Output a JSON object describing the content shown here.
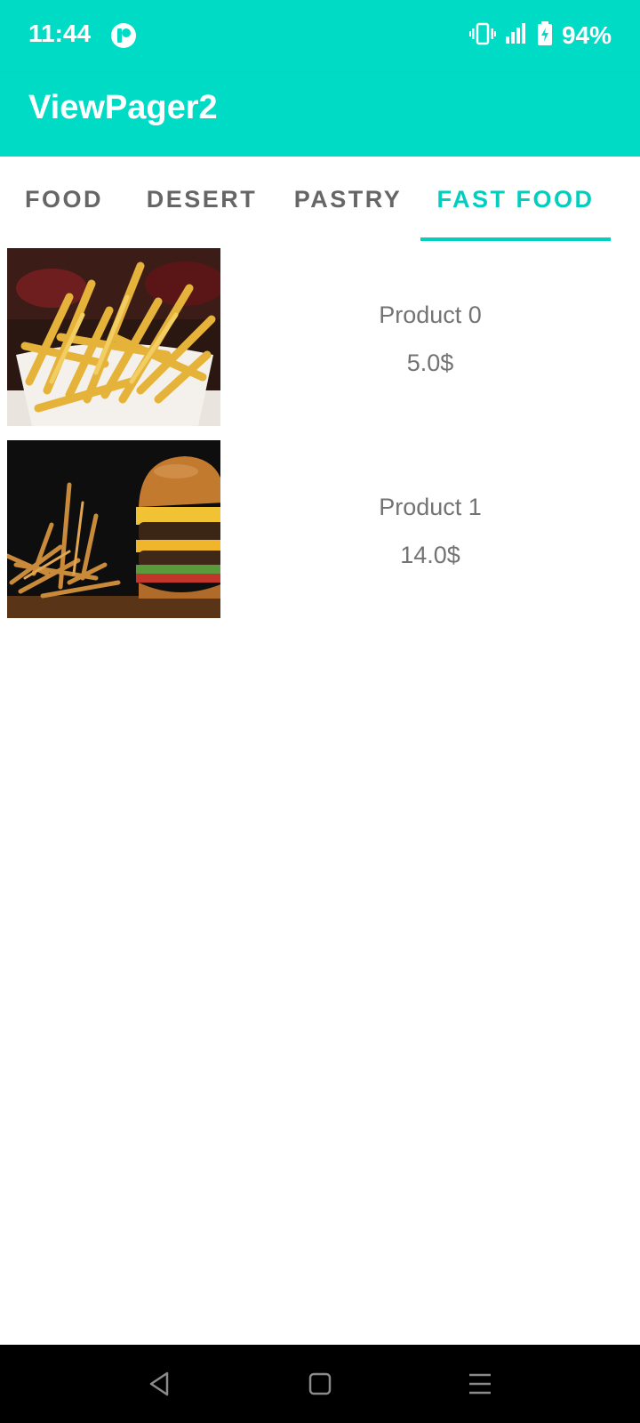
{
  "status_bar": {
    "time": "11:44",
    "battery": "94%",
    "icons": [
      "app-notification-icon",
      "vibrate-icon",
      "signal-icon",
      "battery-charging-icon"
    ]
  },
  "app_bar": {
    "title": "ViewPager2"
  },
  "tabs": [
    {
      "label": "FOOD",
      "active": false
    },
    {
      "label": "DESERT",
      "active": false
    },
    {
      "label": "PASTRY",
      "active": false
    },
    {
      "label": "FAST FOOD",
      "active": true
    }
  ],
  "products": [
    {
      "name": "Product 0",
      "price": "5.0$",
      "image": "french-fries-photo"
    },
    {
      "name": "Product 1",
      "price": "14.0$",
      "image": "burger-and-fries-photo"
    }
  ],
  "nav_bar": {
    "icons": [
      "back-icon",
      "home-icon",
      "recents-icon"
    ]
  },
  "colors": {
    "accent": "#00DBC6",
    "tab_active": "#00CFC0",
    "tab_inactive": "#666666",
    "text_secondary": "#737373"
  }
}
